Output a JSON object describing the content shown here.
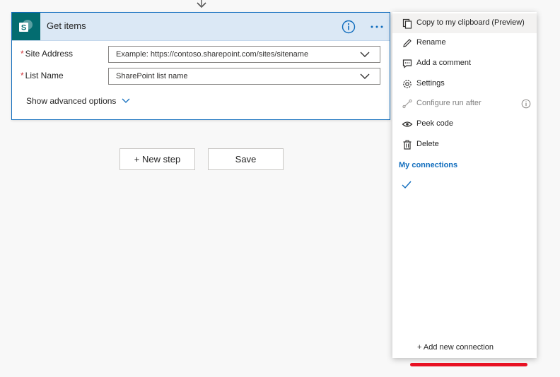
{
  "card": {
    "title": "Get items",
    "fields": [
      {
        "required_mark": "*",
        "label": "Site Address",
        "placeholder": "Example: https://contoso.sharepoint.com/sites/sitename"
      },
      {
        "required_mark": "*",
        "label": "List Name",
        "placeholder": "SharePoint list name"
      }
    ],
    "advanced_options_label": "Show advanced options",
    "icons": {
      "logo": "sharepoint-logo-icon",
      "info": "info-icon",
      "more": "more-options-icon"
    }
  },
  "actions": {
    "new_step_label": "+ New step",
    "save_label": "Save"
  },
  "menu": {
    "items": [
      {
        "label": "Copy to my clipboard (Preview)",
        "icon": "clipboard-icon",
        "state": "hover"
      },
      {
        "label": "Rename",
        "icon": "pencil-icon",
        "state": "normal"
      },
      {
        "label": "Add a comment",
        "icon": "comment-icon",
        "state": "normal"
      },
      {
        "label": "Settings",
        "icon": "gear-icon",
        "state": "normal"
      },
      {
        "label": "Configure run after",
        "icon": "run-after-icon",
        "state": "disabled"
      },
      {
        "label": "Peek code",
        "icon": "eye-icon",
        "state": "normal"
      },
      {
        "label": "Delete",
        "icon": "trash-icon",
        "state": "normal"
      }
    ],
    "connections_header": "My connections",
    "add_connection_label": "+ Add new connection"
  },
  "colors": {
    "accent": "#0f6cbd",
    "sharepoint": "#036c70",
    "header_bg": "#dbe8f5",
    "annotation": "#e81123"
  }
}
